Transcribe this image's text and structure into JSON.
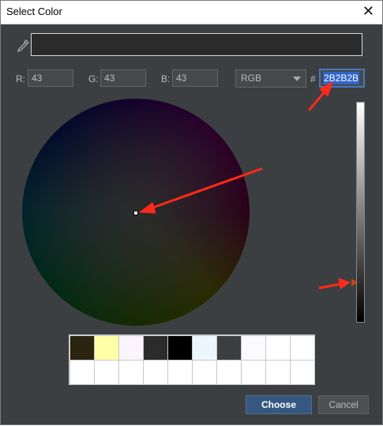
{
  "window": {
    "title": "Select Color"
  },
  "icons": {
    "close": "close-icon",
    "eyedropper": "eyedropper-icon"
  },
  "color": {
    "hex_display": "#2b2b2b"
  },
  "rgb": {
    "r_label": "R:",
    "r_value": "43",
    "g_label": "G:",
    "g_value": "43",
    "b_label": "B:",
    "b_value": "43"
  },
  "mode": {
    "selected": "RGB"
  },
  "hex": {
    "prefix": "#",
    "value": "2B2B2B"
  },
  "swatches": {
    "colors": [
      "#2b2411",
      "#ffffa8",
      "#fbf4fc",
      "#2b2b2b",
      "#000000",
      "#edf6fd",
      "#3c3f41",
      "#fbfbfd",
      "#ffffff",
      "#ffffff",
      "#ffffff",
      "#ffffff",
      "#ffffff",
      "#ffffff",
      "#ffffff",
      "#ffffff",
      "#ffffff",
      "#ffffff",
      "#ffffff",
      "#ffffff"
    ]
  },
  "buttons": {
    "choose": "Choose",
    "cancel": "Cancel"
  },
  "theme": {
    "dialog_bg": "#3c3f41",
    "accent": "#2f65ca",
    "annotation": "#ff2a1a"
  }
}
